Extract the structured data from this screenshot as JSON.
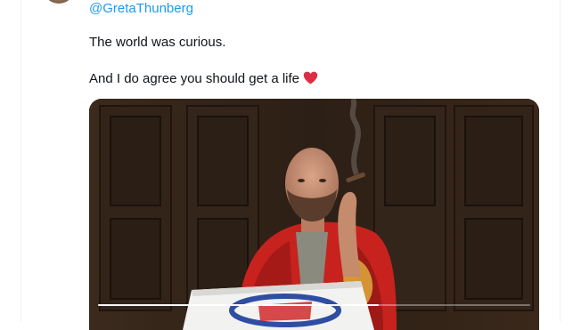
{
  "tweet": {
    "mention": "@GretaThunberg",
    "line1": "The world was curious.",
    "line2": "And I do agree you should get a life",
    "heart_icon": "red-heart-emoji"
  },
  "media": {
    "type": "video",
    "progress": 0.65
  },
  "colors": {
    "link": "#1d9bf0",
    "text": "#0f1419",
    "heart": "#e0245e"
  }
}
